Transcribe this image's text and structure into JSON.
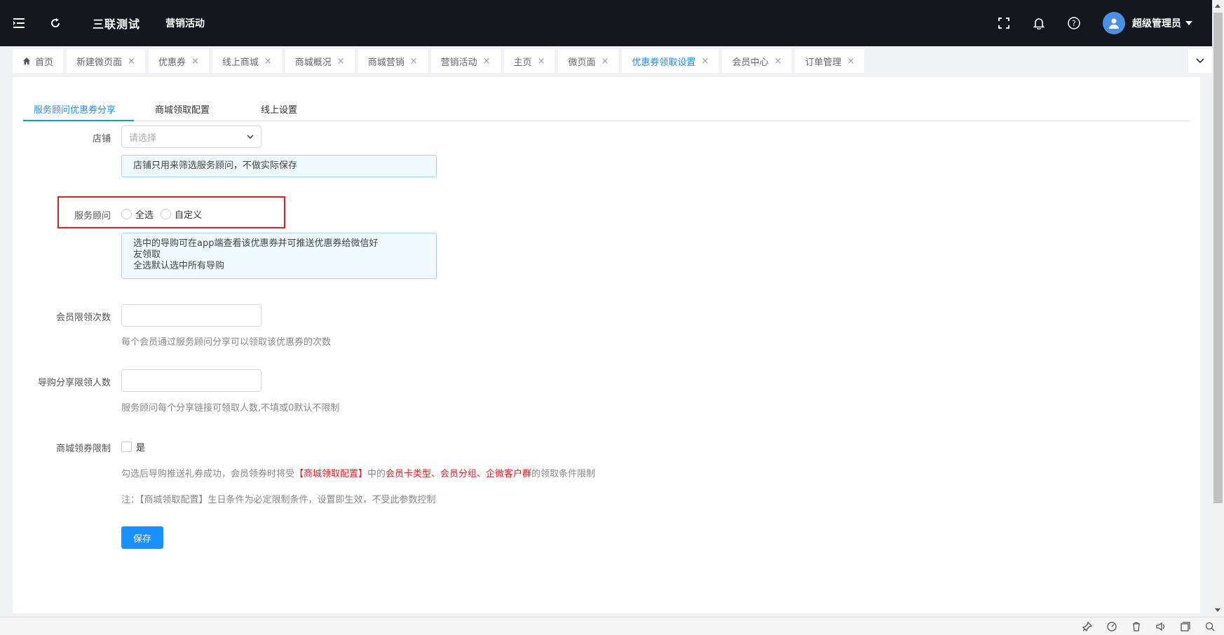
{
  "header": {
    "app_title": "三联测试",
    "subtitle": "营销活动",
    "user_name": "超级管理员"
  },
  "tabs": [
    {
      "label": "首页",
      "closable": false
    },
    {
      "label": "新建微页面",
      "closable": true
    },
    {
      "label": "优惠券",
      "closable": true
    },
    {
      "label": "线上商城",
      "closable": true
    },
    {
      "label": "商城概况",
      "closable": true
    },
    {
      "label": "商城营销",
      "closable": true
    },
    {
      "label": "营销活动",
      "closable": true
    },
    {
      "label": "主页",
      "closable": true
    },
    {
      "label": "微页面",
      "closable": true
    },
    {
      "label": "优惠券领取设置",
      "closable": true,
      "active": true
    },
    {
      "label": "会员中心",
      "closable": true
    },
    {
      "label": "订单管理",
      "closable": true
    }
  ],
  "close_glyph": "×",
  "subtabs": [
    "服务顾问优惠券分享",
    "商城领取配置",
    "线上设置"
  ],
  "form": {
    "store_label": "店铺",
    "store_placeholder": "请选择",
    "store_tip": "店铺只用来筛选服务顾问，不做实际保存",
    "advisor_label": "服务顾问",
    "advisor_option_all": "全选",
    "advisor_option_custom": "自定义",
    "advisor_tip_line1": "选中的导购可在app端查看该优惠券并可推送优惠券给微信好",
    "advisor_tip_line2": "友领取",
    "advisor_tip_line3": "全选默认选中所有导购",
    "member_limit_label": "会员限领次数",
    "member_limit_value": "",
    "member_limit_hint": "每个会员通过服务顾问分享可以领取该优惠券的次数",
    "guide_limit_label": "导购分享限领人数",
    "guide_limit_value": "",
    "guide_limit_hint": "服务顾问每个分享链接可领取人数,不填或0默认不限制",
    "mall_limit_label": "商城领券限制",
    "mall_limit_option": "是",
    "mall_hint_part1": "勾选后导购推送礼券成功，会员领券时将受",
    "mall_hint_red1": "【商城领取配置】",
    "mall_hint_part2": "中的",
    "mall_hint_red2": "会员卡类型、会员分组、企微客户群",
    "mall_hint_part3": "的领取条件限制",
    "mall_note": "注：【商城领取配置】生日条件为必定限制条件，设置即生效，不受此参数控制",
    "save_label": "保存"
  },
  "colors": {
    "accent": "#1890ff",
    "topbar_bg": "#15171e",
    "highlight": "#e02020"
  }
}
